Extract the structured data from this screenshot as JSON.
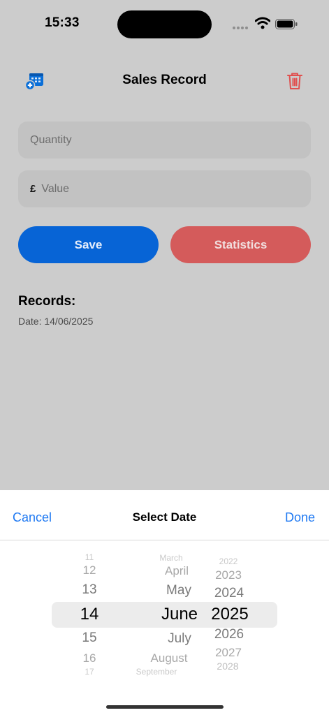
{
  "status": {
    "time": "15:33"
  },
  "header": {
    "title": "Sales Record",
    "calendar_icon": "calendar-add-icon",
    "trash_icon": "trash-icon"
  },
  "form": {
    "quantity_placeholder": "Quantity",
    "value_currency": "£",
    "value_placeholder": "Value"
  },
  "buttons": {
    "save": "Save",
    "statistics": "Statistics"
  },
  "records": {
    "heading": "Records:",
    "items": [
      "Date: 14/06/2025"
    ]
  },
  "picker": {
    "cancel": "Cancel",
    "title": "Select Date",
    "done": "Done",
    "days": [
      "11",
      "12",
      "13",
      "14",
      "15",
      "16",
      "17"
    ],
    "months": [
      "March",
      "April",
      "May",
      "June",
      "July",
      "August",
      "September"
    ],
    "years": [
      "2022",
      "2023",
      "2024",
      "2025",
      "2026",
      "2027",
      "2028"
    ],
    "selected": {
      "day": "14",
      "month": "June",
      "year": "2025"
    }
  },
  "colors": {
    "accent_blue": "#0764d6",
    "link_blue": "#1f79f2",
    "danger_red": "#d45b5b",
    "trash_red": "#e0504f"
  }
}
